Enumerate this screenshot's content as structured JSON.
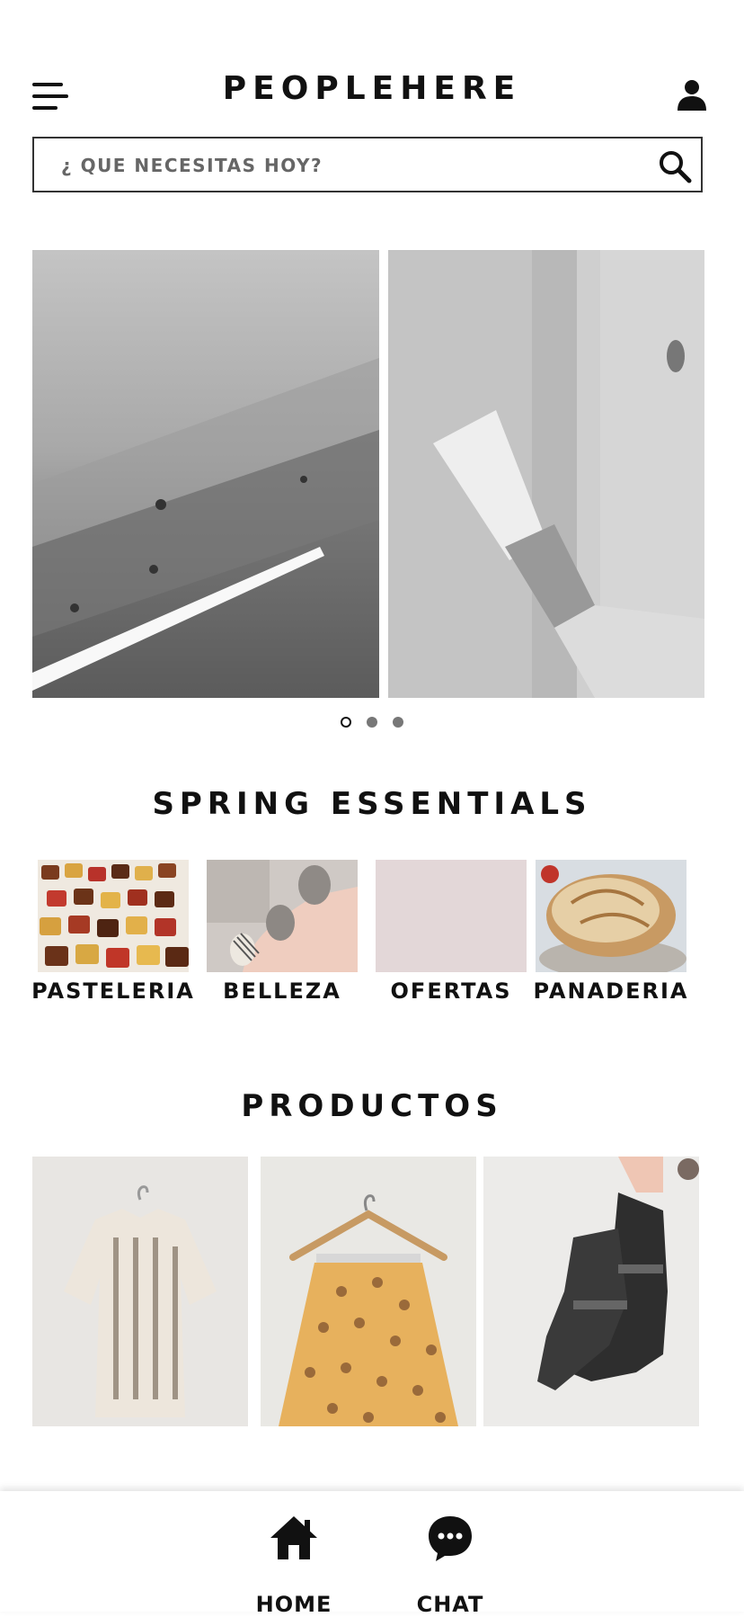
{
  "header": {
    "brand": "PEOPLEHERE",
    "menu_icon": "hamburger-menu-icon",
    "user_icon": "user-icon"
  },
  "search": {
    "placeholder": "¿ QUE NECESITAS HOY?",
    "value": "",
    "icon": "search-icon"
  },
  "carousel": {
    "slides": [
      {
        "image": "wooden plank with white paint stroke"
      },
      {
        "image": "paint brush on wooden post"
      }
    ],
    "dot_count": 3,
    "active_index": 0
  },
  "spring": {
    "title": "SPRING ESSENTIALS",
    "categories": [
      {
        "label": "PASTELERIA"
      },
      {
        "label": "BELLEZA"
      },
      {
        "label": "OFERTAS"
      },
      {
        "label": "PANADERIA"
      }
    ]
  },
  "products": {
    "title": "PRODUCTOS"
  },
  "bottom_nav": {
    "items": [
      {
        "label": "HOME",
        "icon": "home-icon"
      },
      {
        "label": "CHAT",
        "icon": "chat-icon"
      }
    ]
  },
  "colors": {
    "text": "#111111",
    "ofertas_tile": "#e3d7d8",
    "dot_inactive": "#777777"
  }
}
